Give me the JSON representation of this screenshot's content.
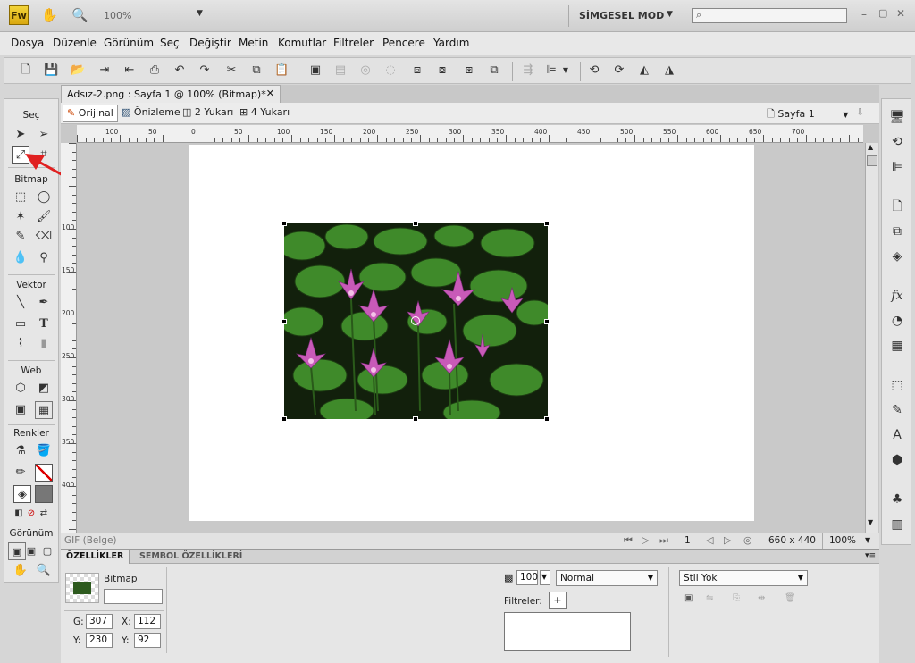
{
  "app": {
    "logo": "Fw",
    "zoom": "100%",
    "mode": "SİMGESEL MOD",
    "search_placeholder": ""
  },
  "menu": [
    "Dosya",
    "Düzenle",
    "Görünüm",
    "Seç",
    "Değiştir",
    "Metin",
    "Komutlar",
    "Filtreler",
    "Pencere",
    "Yardım"
  ],
  "document": {
    "tab_title": "Adsız-2.png : Sayfa 1 @ 100% (Bitmap)*",
    "views": [
      "Orijinal",
      "Önizleme",
      "2 Yukarı",
      "4 Yukarı"
    ],
    "page": "Sayfa 1"
  },
  "tools": {
    "sections": [
      "Seç",
      "Bitmap",
      "Vektör",
      "Web",
      "Renkler",
      "Görünüm"
    ]
  },
  "rulers": {
    "h": [
      "100",
      "50",
      "0",
      "50",
      "100",
      "150",
      "200",
      "250",
      "300",
      "350",
      "400",
      "450",
      "500",
      "550",
      "600",
      "650",
      "700"
    ],
    "v": [
      "100",
      "150",
      "200",
      "250",
      "300",
      "350",
      "400"
    ]
  },
  "status": {
    "format": "GIF (Belge)",
    "page_num": "1",
    "size": "660 x 440",
    "zoom": "100%"
  },
  "properties": {
    "tabs": [
      "ÖZELLİKLER",
      "SEMBOL ÖZELLİKLERİ"
    ],
    "object_type": "Bitmap",
    "object_name": "",
    "w_label": "G:",
    "w": "307",
    "h_label": "Y:",
    "h": "230",
    "x_label": "X:",
    "x": "112",
    "y_label": "Y:",
    "y": "92",
    "opacity": "100",
    "blend": "Normal",
    "filters_label": "Filtreler:",
    "style": "Stil Yok"
  }
}
